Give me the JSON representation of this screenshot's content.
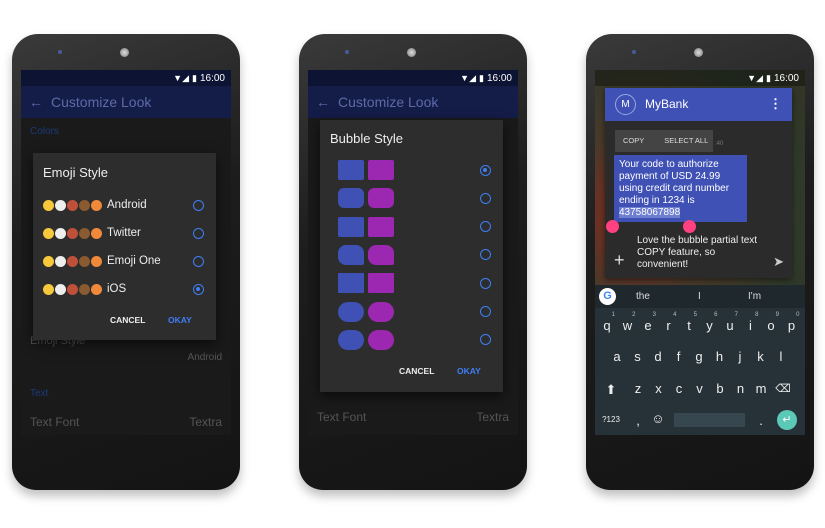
{
  "status_bar": {
    "time": "16:00"
  },
  "phone1": {
    "app_bar": {
      "title": "Customize Look"
    },
    "background": {
      "section_colors": "Colors",
      "emoji_style_label": "Emoji Style",
      "emoji_style_value": "Android",
      "section_text": "Text",
      "text_font_label": "Text Font",
      "text_font_value": "Textra"
    },
    "dialog": {
      "title": "Emoji Style",
      "options": [
        {
          "label": "Android",
          "selected": false,
          "emoji": [
            "grinning-face",
            "panda",
            "rocket",
            "poop",
            "gift"
          ]
        },
        {
          "label": "Twitter",
          "selected": false,
          "emoji": [
            "grinning-face",
            "panda",
            "rocket",
            "poop",
            "gift"
          ]
        },
        {
          "label": "Emoji One",
          "selected": false,
          "emoji": [
            "grinning-face",
            "panda",
            "rocket",
            "poop",
            "gift"
          ]
        },
        {
          "label": "iOS",
          "selected": true,
          "emoji": [
            "grinning-face",
            "panda",
            "rocket",
            "poop",
            "gift"
          ]
        }
      ],
      "cancel": "CANCEL",
      "okay": "OKAY"
    }
  },
  "phone2": {
    "app_bar": {
      "title": "Customize Look"
    },
    "background": {
      "text_font_label": "Text Font",
      "text_font_value": "Textra"
    },
    "dialog": {
      "title": "Bubble Style",
      "options": [
        {
          "style": "square-side-tail",
          "selected": true
        },
        {
          "style": "rounded-side-tail",
          "selected": false
        },
        {
          "style": "square-point-tail",
          "selected": false
        },
        {
          "style": "rounded-corner-tail",
          "selected": false
        },
        {
          "style": "flared-top",
          "selected": false
        },
        {
          "style": "round-speech-tail",
          "selected": false
        },
        {
          "style": "pill",
          "selected": false
        }
      ],
      "cancel": "CANCEL",
      "okay": "OKAY"
    },
    "colors": {
      "incoming": "#3f51b5",
      "outgoing": "#9c27b0"
    }
  },
  "phone3": {
    "header": {
      "avatar": "M",
      "title": "MyBank"
    },
    "selection_toolbar": {
      "copy": "COPY",
      "select_all": "SELECT ALL",
      "timestamp": ":40"
    },
    "message": {
      "text": "Your code to authorize payment of USD 24.99 using credit card number ending in 1234 is ",
      "selected": "43758067898"
    },
    "compose": {
      "text": "Love the bubble partial text COPY feature, so convenient!"
    },
    "suggestions": [
      "the",
      "I",
      "I'm"
    ],
    "keyboard": {
      "row1": [
        "q",
        "w",
        "e",
        "r",
        "t",
        "y",
        "u",
        "i",
        "o",
        "p"
      ],
      "row1_hints": [
        "1",
        "2",
        "3",
        "4",
        "5",
        "6",
        "7",
        "8",
        "9",
        "0"
      ],
      "row2": [
        "a",
        "s",
        "d",
        "f",
        "g",
        "h",
        "j",
        "k",
        "l"
      ],
      "row3": [
        "z",
        "x",
        "c",
        "v",
        "b",
        "n",
        "m"
      ],
      "symbols": "?123",
      "comma": ",",
      "period": "."
    },
    "colors": {
      "header": "#3f51b5",
      "handle": "#ff4081",
      "enter": "#5cc8b8"
    }
  }
}
